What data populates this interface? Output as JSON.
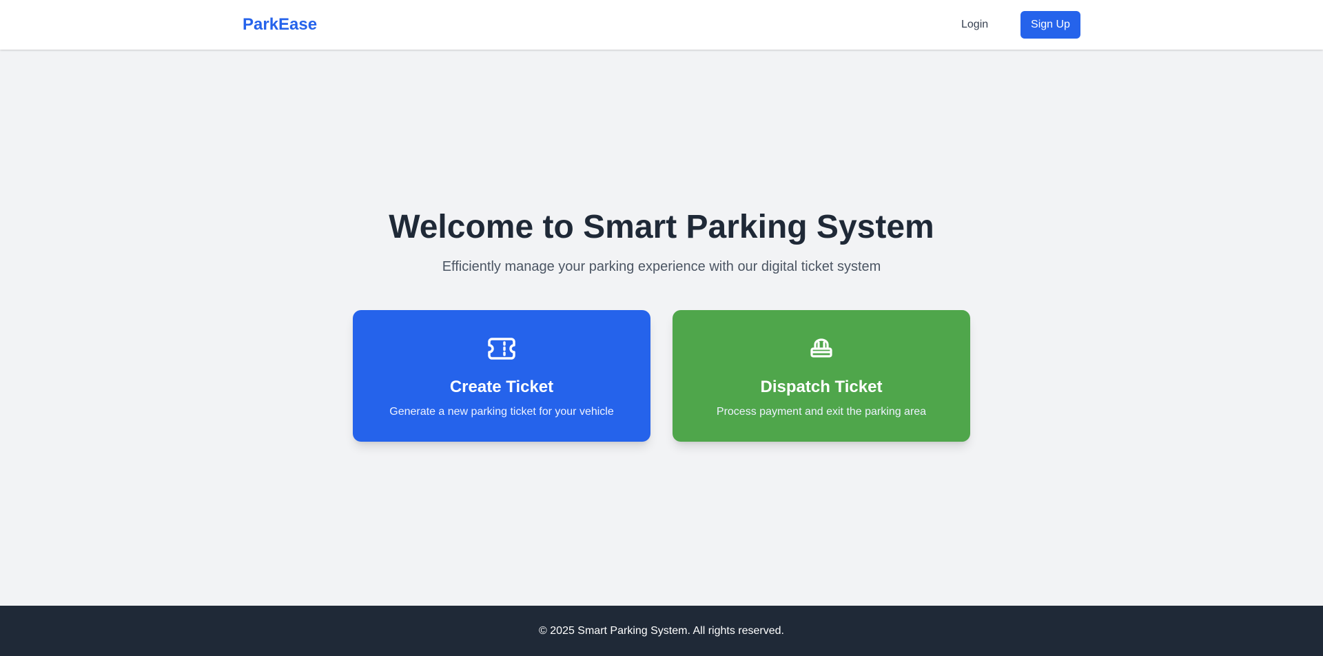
{
  "header": {
    "brand": "ParkEase",
    "login_label": "Login",
    "signup_label": "Sign Up"
  },
  "hero": {
    "title": "Welcome to Smart Parking System",
    "subtitle": "Efficiently manage your parking experience with our digital ticket system"
  },
  "cards": [
    {
      "icon": "ticket-icon",
      "title": "Create Ticket",
      "description": "Generate a new parking ticket for your vehicle",
      "color": "#2563eb"
    },
    {
      "icon": "toll-booth-icon",
      "title": "Dispatch Ticket",
      "description": "Process payment and exit the parking area",
      "color": "#4fa64b"
    }
  ],
  "footer": {
    "text": "© 2025 Smart Parking System. All rights reserved."
  },
  "colors": {
    "accent": "#2563eb",
    "success": "#4fa64b",
    "page_background": "#f2f3f5",
    "footer_background": "#1f2937",
    "heading": "#1f2937"
  }
}
